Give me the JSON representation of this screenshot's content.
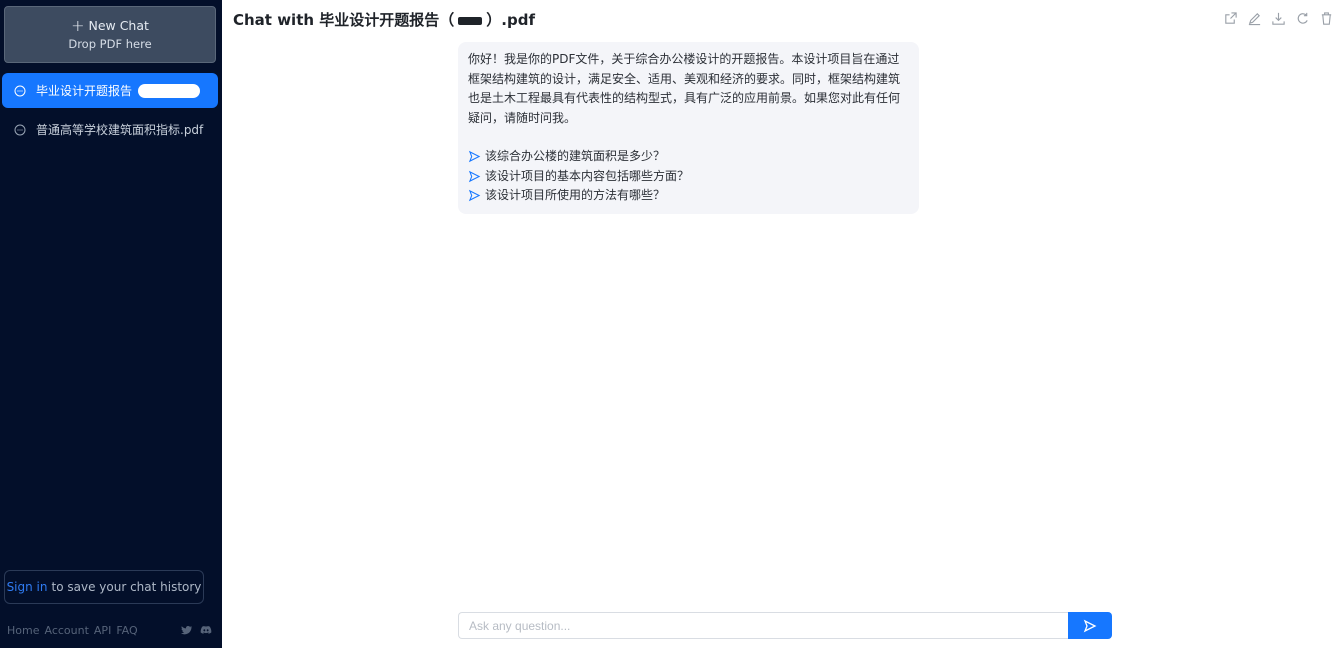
{
  "sidebar": {
    "new_chat_label": "New Chat",
    "drop_label": "Drop PDF here",
    "items": [
      {
        "label": "毕业设计开题报告",
        "active": true
      },
      {
        "label": "普通高等学校建筑面积指标.pdf",
        "active": false
      }
    ],
    "signin_link": "Sign in",
    "signin_text": "to save your chat history",
    "footer": [
      "Home",
      "Account",
      "API",
      "FAQ"
    ]
  },
  "header": {
    "prefix": "Chat with ",
    "doc_name": "毕业设计开题报告（",
    "doc_suffix": "）.pdf"
  },
  "message": {
    "intro": "你好！我是你的PDF文件，关于综合办公楼设计的开题报告。本设计项目旨在通过框架结构建筑的设计，满足安全、适用、美观和经济的要求。同时，框架结构建筑也是土木工程最具有代表性的结构型式，具有广泛的应用前景。如果您对此有任何疑问，请随时问我。",
    "questions": [
      "该综合办公楼的建筑面积是多少？",
      "该设计项目的基本内容包括哪些方面？",
      "该设计项目所使用的方法有哪些？"
    ]
  },
  "input": {
    "placeholder": "Ask any question..."
  },
  "colors": {
    "sidebar_bg": "#030f2a",
    "accent": "#1677ff"
  }
}
